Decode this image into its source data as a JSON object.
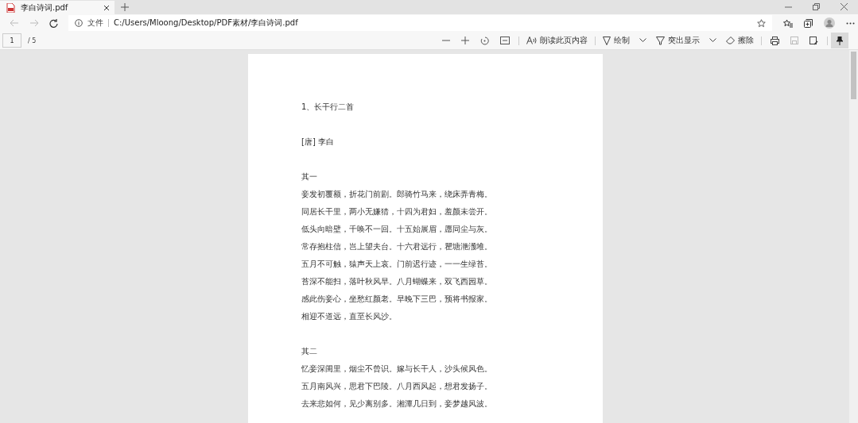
{
  "tab": {
    "title": "李白诗词.pdf",
    "selected": true
  },
  "address_bar": {
    "scheme": "文件",
    "url": "C:/Users/Mloong/Desktop/PDF素材/李白诗词.pdf"
  },
  "pdf_toolbar": {
    "page": "1",
    "page_total": "/ 5",
    "read_aloud": "朗读此页内容",
    "draw": "绘制",
    "highlight": "突出显示",
    "erase": "擦除",
    "pinned": true
  },
  "document": {
    "heading": "1、长干行二首",
    "author": "[唐] 李白",
    "sections": [
      {
        "title": "其一",
        "lines": [
          "妾发初覆额，折花门前剧。郎骑竹马来，绕床弄青梅。",
          "同居长干里，两小无嫌猜，十四为君妇，羞颜未尝开。",
          "低头向暗壁，千唤不一回。十五始展眉，愿同尘与灰。",
          "常存抱柱信，岂上望夫台。十六君远行，瞿塘滟滪堆。",
          "五月不可触，猿声天上哀。门前迟行迹，一一生绿苔。",
          "苔深不能扫，落叶秋风早。八月蝴蝶来，双飞西园草。",
          "感此伤妾心，坐愁红颜老。早晚下三巴，预将书报家。",
          "相迎不道远，直至长风沙。"
        ]
      },
      {
        "title": "其二",
        "lines": [
          "忆妾深闺里，烟尘不曾识。嫁与长干人，沙头候风色。",
          "五月南风兴，思君下巴陵。八月西风起，想君发扬子。",
          "去来悲如何，见少离别多。湘潭几日到，妾梦越风波。"
        ]
      }
    ]
  }
}
